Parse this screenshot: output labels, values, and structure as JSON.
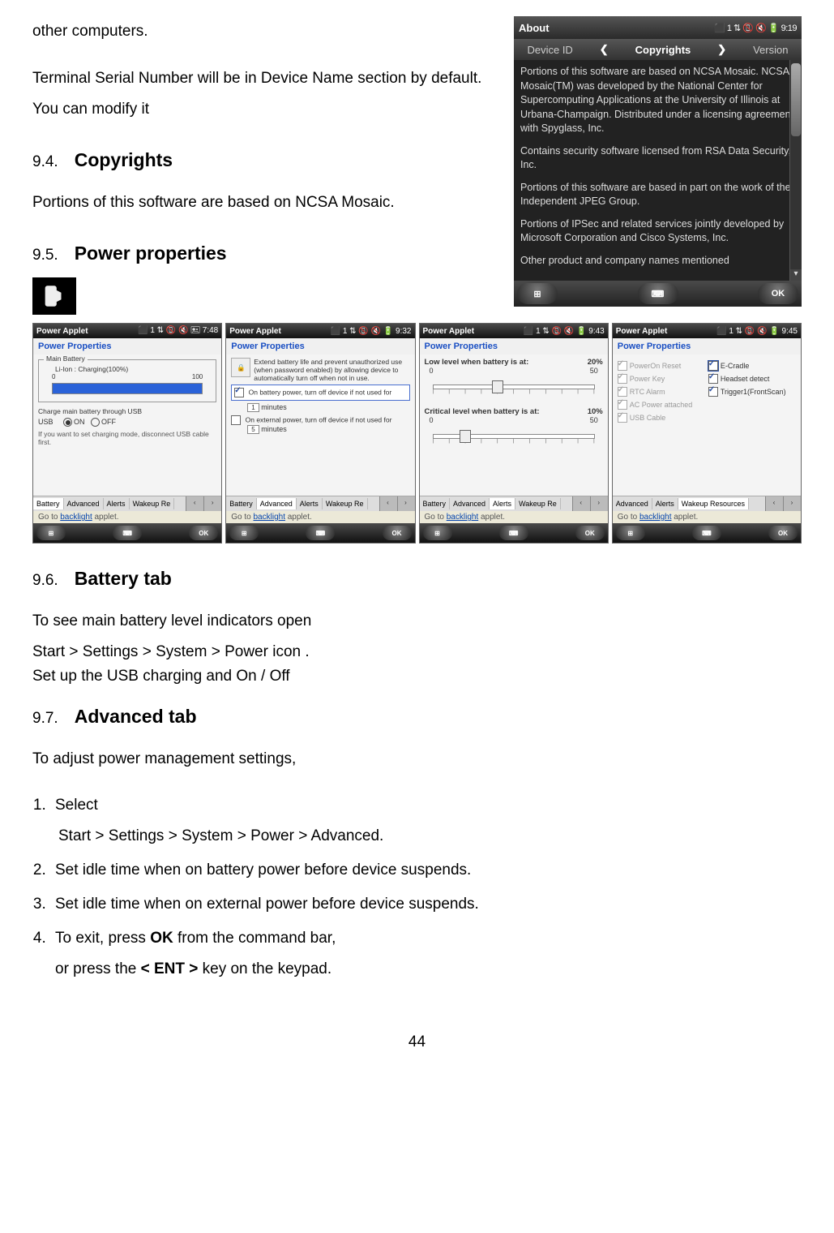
{
  "intro": {
    "line1": "other computers.",
    "line2": "Terminal Serial Number will be in Device Name section by default. You can modify it"
  },
  "sections": {
    "copyrights": {
      "num": "9.4.",
      "title": "Copyrights",
      "body": "Portions of this software are based on NCSA Mosaic."
    },
    "power_props": {
      "num": "9.5.",
      "title": "Power properties"
    },
    "battery_tab": {
      "num": "9.6.",
      "title": "Battery tab",
      "b1": "To see main battery level indicators open",
      "b2": "Start > Settings > System > Power icon .",
      "b3": "Set up the USB charging and On / Off"
    },
    "advanced_tab": {
      "num": "9.7.",
      "title": "Advanced tab",
      "intro": "To adjust power management settings,",
      "steps": [
        "Select",
        "Set idle time when on battery power before device suspends.",
        "Set idle time when on external power before device suspends.",
        "To exit, press OK from the command bar,"
      ],
      "step1_sub": "Start > Settings > System > Power > Advanced.",
      "step4_sub": "or press the < ENT > key on the keypad."
    }
  },
  "about_screen": {
    "title": "About",
    "status": "⬛ 1 ⇅ 📵 🔇 🔋 9:19",
    "tabs": {
      "left": "Device ID",
      "mid": "Copyrights",
      "right": "Version"
    },
    "p1": "Portions of this software are based on NCSA Mosaic. NCSA Mosaic(TM) was developed by the National Center for Supercomputing Applications at the University of Illinois at Urbana-Champaign. Distributed under a licensing agreement with Spyglass, Inc.",
    "p2": "Contains security software licensed from RSA Data Security, Inc.",
    "p3": "Portions of this software are based in part on the work of the Independent JPEG Group.",
    "p4": "Portions of IPSec and related services jointly developed by Microsoft Corporation and Cisco Systems, Inc.",
    "p5": "Other product and company names mentioned",
    "ok": "OK"
  },
  "power_screens": {
    "common": {
      "applet": "Power Applet",
      "pp": "Power Properties",
      "backlight_pre": "Go to ",
      "backlight_link": "backlight",
      "backlight_post": " applet.",
      "ok": "OK",
      "tabs_full": [
        "Battery",
        "Advanced",
        "Alerts",
        "Wakeup Re"
      ],
      "tabs_alt": [
        "Advanced",
        "Alerts",
        "Wakeup Resources"
      ]
    },
    "s1": {
      "time": "7:48",
      "legend": "Main Battery",
      "battery_type": "Li-Ion : Charging(100%)",
      "scale_lo": "0",
      "scale_hi": "100",
      "usb_charge": "Charge main battery through USB",
      "usb": "USB",
      "on": "ON",
      "off": "OFF",
      "note": "If you want to set charging mode, disconnect USB cable first."
    },
    "s2": {
      "time": "9:32",
      "extend": "Extend battery life and prevent unauthorized use (when password enabled) by allowing device to automatically turn off when not in use.",
      "bat_off": "On battery power, turn off device if not used for",
      "bat_min": "1",
      "min_lbl": "minutes",
      "ext_off": "On external power, turn off device if not used for",
      "ext_min": "5"
    },
    "s3": {
      "time": "9:43",
      "low_label": "Low level when battery is at:",
      "low_pct": "20%",
      "crit_label": "Critical level when battery is at:",
      "crit_pct": "10%",
      "lo": "0",
      "hi": "50"
    },
    "s4": {
      "time": "9:45",
      "left_items": [
        "PowerOn Reset",
        "Power Key",
        "RTC Alarm",
        "AC Power attached",
        "USB Cable"
      ],
      "right_items": [
        "E-Cradle",
        "Headset detect",
        "Trigger1(FrontScan)"
      ]
    }
  },
  "page_number": "44"
}
